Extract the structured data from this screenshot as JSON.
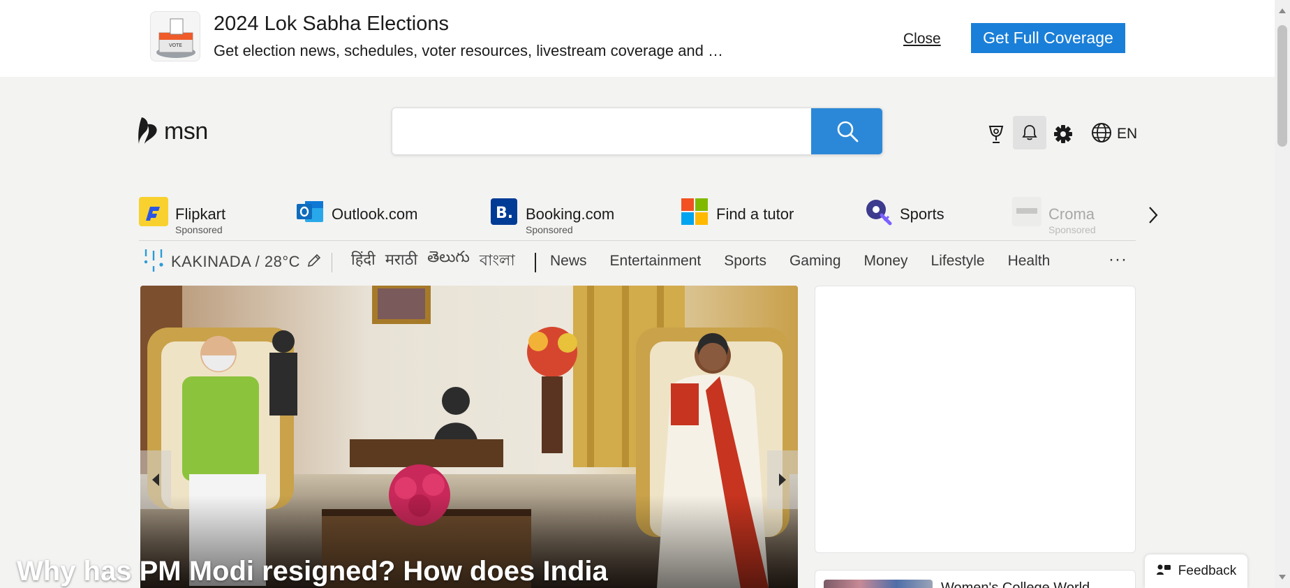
{
  "banner": {
    "title": "2024 Lok Sabha Elections",
    "subtitle": "Get election news, schedules, voter resources, livestream coverage and …",
    "close_label": "Close",
    "cta_label": "Get Full Coverage",
    "logo_icon": "ballot-box-icon",
    "logo_text": "VOTE"
  },
  "header": {
    "brand": "msn",
    "brand_icon": "msn-butterfly-icon",
    "search": {
      "value": "",
      "placeholder": "",
      "button_icon": "search-icon"
    },
    "icons": [
      "rewards-trophy-icon",
      "notifications-bell-icon",
      "settings-gear-icon",
      "globe-icon"
    ],
    "language": "EN"
  },
  "quicklinks": {
    "items": [
      {
        "label": "Flipkart",
        "sponsored": "Sponsored",
        "icon": "flipkart-icon",
        "color": "#f8d12f"
      },
      {
        "label": "Outlook.com",
        "sponsored": "",
        "icon": "outlook-icon",
        "color": "#0f6cbd"
      },
      {
        "label": "Booking.com",
        "sponsored": "Sponsored",
        "icon": "booking-icon",
        "color": "#003b95"
      },
      {
        "label": "Find a tutor",
        "sponsored": "",
        "icon": "microsoft-icon",
        "color": "#f25022"
      },
      {
        "label": "Sports",
        "sponsored": "",
        "icon": "sports-icon",
        "color": "#3d3b8e"
      },
      {
        "label": "Croma",
        "sponsored": "Sponsored",
        "icon": "croma-icon",
        "color": "#9a9a9a"
      }
    ],
    "next_icon": "chevron-right-icon"
  },
  "nav": {
    "weather": {
      "text": "KAKINADA / 28°C",
      "icon": "rain-icon",
      "edit_icon": "pencil-icon"
    },
    "languages": [
      "हिंदी",
      "मराठी",
      "తెలుగు",
      "বাংলা"
    ],
    "links": [
      "News",
      "Entertainment",
      "Sports",
      "Gaming",
      "Money",
      "Lifestyle",
      "Health"
    ],
    "more": "···"
  },
  "hero": {
    "title": "Why has PM Modi resigned? How does India",
    "prev_icon": "arrow-left-icon",
    "next_icon": "arrow-right-icon"
  },
  "side": {
    "news_title": "Women's College World…"
  },
  "feedback": {
    "label": "Feedback",
    "icon": "feedback-icon"
  },
  "colors": {
    "accent": "#2b88d8",
    "cta": "#1a7fd8",
    "page_bg": "#f3f3f2"
  }
}
